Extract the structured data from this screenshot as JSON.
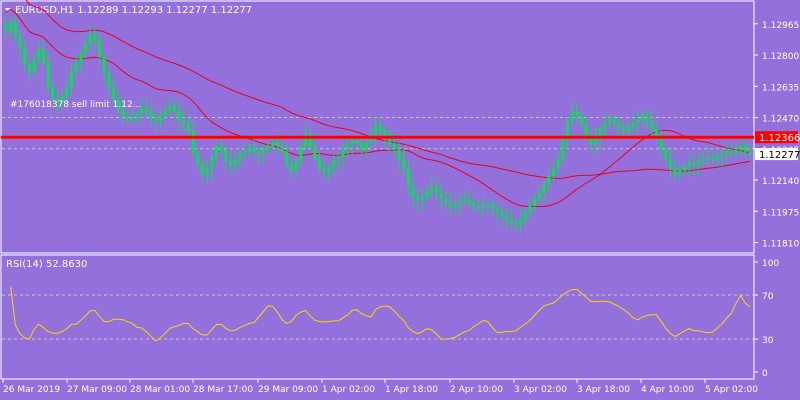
{
  "chart_data": [
    {
      "type": "candlestick",
      "title": "EURUSD,H1  1.12289 1.12293 1.12277 1.12277",
      "symbol": "EURUSD",
      "timeframe": "H1",
      "ohlc_last": {
        "open": 1.12289,
        "high": 1.12293,
        "low": 1.12277,
        "close": 1.12277
      },
      "ylim": [
        1.1176,
        1.1308
      ],
      "y_ticks": [
        "1.12965",
        "1.12800",
        "1.12635",
        "1.12470",
        "1.12305",
        "1.12140",
        "1.11975",
        "1.11810"
      ],
      "x_ticks": [
        "26 Mar 2019",
        "27 Mar 09:00",
        "28 Mar 01:00",
        "28 Mar 17:00",
        "29 Mar 09:00",
        "1 Apr 02:00",
        "1 Apr 18:00",
        "2 Apr 10:00",
        "3 Apr 02:00",
        "3 Apr 18:00",
        "4 Apr 10:00",
        "5 Apr 02:00"
      ],
      "order_label": "#176018378 sell limit 1.12...",
      "sell_limit_price": 1.12366,
      "sell_limit_label": "1.12366",
      "current_price": 1.12277,
      "current_price_label": "1.12277",
      "grid_levels": [
        1.1247,
        1.12305
      ],
      "closes": [
        1.1293,
        1.1297,
        1.129,
        1.1283,
        1.1275,
        1.1271,
        1.1278,
        1.1283,
        1.1276,
        1.1263,
        1.1257,
        1.1255,
        1.1258,
        1.1263,
        1.1272,
        1.1276,
        1.1281,
        1.1286,
        1.1291,
        1.1288,
        1.1279,
        1.127,
        1.1263,
        1.1257,
        1.1251,
        1.1248,
        1.1246,
        1.1247,
        1.1249,
        1.1252,
        1.125,
        1.1247,
        1.1245,
        1.1248,
        1.1251,
        1.1253,
        1.125,
        1.1246,
        1.1244,
        1.124,
        1.1228,
        1.1222,
        1.1217,
        1.122,
        1.1226,
        1.1232,
        1.123,
        1.1224,
        1.1222,
        1.1225,
        1.1228,
        1.1229,
        1.1231,
        1.1229,
        1.1228,
        1.123,
        1.1232,
        1.1234,
        1.1232,
        1.1229,
        1.1222,
        1.1219,
        1.1224,
        1.1232,
        1.1238,
        1.1231,
        1.1225,
        1.122,
        1.1218,
        1.1221,
        1.1224,
        1.1226,
        1.123,
        1.1233,
        1.1235,
        1.1233,
        1.123,
        1.1234,
        1.1238,
        1.1243,
        1.124,
        1.1236,
        1.1233,
        1.123,
        1.1225,
        1.122,
        1.121,
        1.1205,
        1.1203,
        1.1205,
        1.1208,
        1.121,
        1.1207,
        1.1204,
        1.1202,
        1.12,
        1.1201,
        1.1203,
        1.1204,
        1.1202,
        1.12,
        1.1199,
        1.12,
        1.1201,
        1.1199,
        1.1197,
        1.1195,
        1.1193,
        1.1191,
        1.119,
        1.1193,
        1.1197,
        1.1201,
        1.1204,
        1.1207,
        1.1212,
        1.1216,
        1.122,
        1.1225,
        1.1235,
        1.1245,
        1.125,
        1.1248,
        1.1243,
        1.1238,
        1.1233,
        1.1236,
        1.1241,
        1.1244,
        1.1246,
        1.1244,
        1.1242,
        1.124,
        1.1242,
        1.1244,
        1.1246,
        1.1248,
        1.1245,
        1.1241,
        1.1236,
        1.123,
        1.1225,
        1.122,
        1.1217,
        1.1219,
        1.1221,
        1.1223,
        1.1222,
        1.1224,
        1.1225,
        1.1226,
        1.1225,
        1.1227,
        1.1228,
        1.1229,
        1.1228,
        1.123,
        1.1232,
        1.1229,
        1.1228
      ]
    },
    {
      "type": "line",
      "title": "RSI(14) 52.8630",
      "ylim": [
        0,
        100
      ],
      "y_ticks": [
        100,
        70,
        30,
        0
      ],
      "levels": [
        70,
        30
      ],
      "last_value": 52.863
    }
  ],
  "colors": {
    "background": "#9370DB",
    "bull_candle": "#00E64D",
    "bear_candle": "#00E64D",
    "ma_line": "#E8001F",
    "order_line": "#FF0000",
    "rsi_line": "#FFD700",
    "price_tag_order": "#FF0000",
    "price_tag_current": "#FFFFFF",
    "grid": "#C8C8C8",
    "text": "#FFFFFF"
  }
}
